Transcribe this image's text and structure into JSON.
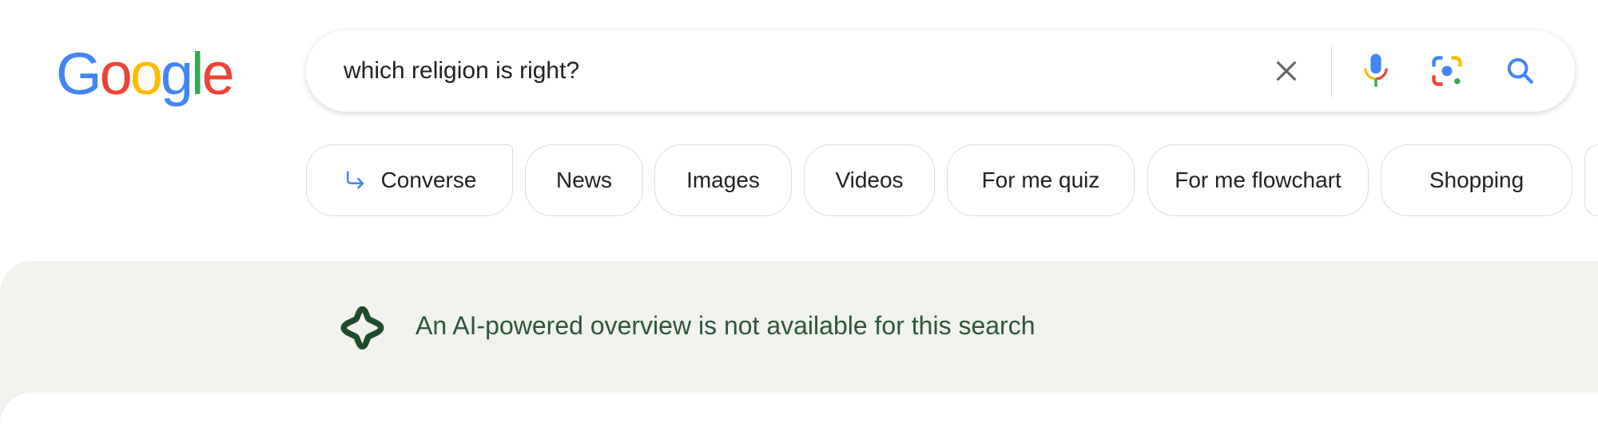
{
  "logo": {
    "text": "Google",
    "letters": [
      "G",
      "o",
      "o",
      "g",
      "l",
      "e"
    ],
    "colors": [
      "#4285f4",
      "#ea4335",
      "#fbbc05",
      "#4285f4",
      "#34a853",
      "#ea4335"
    ]
  },
  "search": {
    "query": "which religion is right?",
    "icons": [
      "close-icon",
      "microphone-icon",
      "google-lens-icon",
      "search-icon"
    ]
  },
  "chips": [
    {
      "label": "Converse",
      "icon": "arrow-return-icon"
    },
    {
      "label": "News"
    },
    {
      "label": "Images"
    },
    {
      "label": "Videos"
    },
    {
      "label": "For me quiz"
    },
    {
      "label": "For me flowchart"
    },
    {
      "label": "Shopping"
    }
  ],
  "ai_overview": {
    "message": "An AI-powered overview is not available for this search",
    "icon": "ai-sparkle-icon",
    "color": "#2b5738",
    "background": "#f1f2ee"
  }
}
